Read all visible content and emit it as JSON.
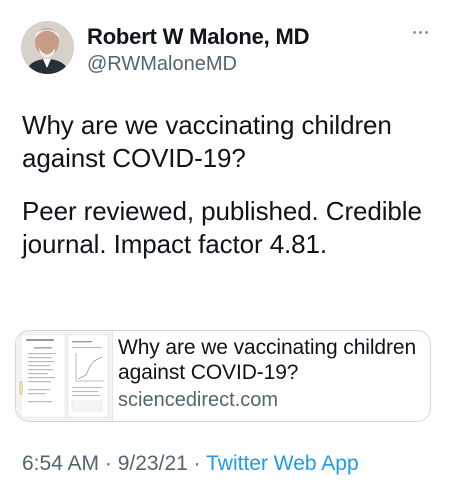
{
  "author": {
    "display_name": "Robert W Malone, MD",
    "handle": "@RWMaloneMD"
  },
  "tweet": {
    "paragraphs": [
      "Why are we vaccinating children against COVID-19?",
      "Peer reviewed, published. Credible journal. Impact factor 4.81."
    ]
  },
  "link_card": {
    "title": "Why are we vaccinating children against COVID-19?",
    "domain": "sciencedirect.com"
  },
  "meta": {
    "time": "6:54 AM",
    "separator": " · ",
    "date": "9/23/21",
    "source": "Twitter Web App"
  },
  "icons": {
    "more": "more-horizontal-icon"
  },
  "colors": {
    "text": "#0f1419",
    "secondary": "#536471",
    "link": "#1d9bf0",
    "border": "#cfd9de"
  }
}
